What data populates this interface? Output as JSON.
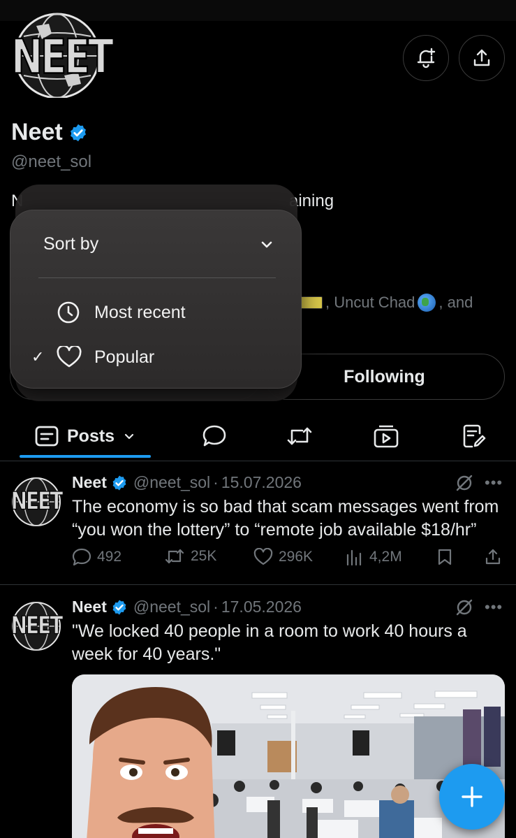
{
  "profile": {
    "name": "Neet",
    "handle": "@neet_sol",
    "logo_text": "NEET",
    "bio_fragment_left": "N",
    "bio_fragment_right": "aining",
    "followed_by": ", Uncut Chad",
    "followed_and": ", and",
    "following_label": "Following"
  },
  "header": {
    "notify_icon": "bell-plus-icon",
    "share_icon": "share-icon"
  },
  "sort_popover": {
    "title": "Sort by",
    "options": [
      {
        "label": "Most recent",
        "icon": "clock-icon",
        "selected": false
      },
      {
        "label": "Popular",
        "icon": "heart-icon",
        "selected": true
      }
    ]
  },
  "tabs": {
    "posts_label": "Posts",
    "items": [
      "posts",
      "replies",
      "reposts",
      "videos",
      "articles"
    ]
  },
  "posts": [
    {
      "name": "Neet",
      "handle": "@neet_sol",
      "date": "15.07.2026",
      "text": "The economy is so bad that scam messages went from “you won the lottery” to “remote job available $18/hr”",
      "replies": "492",
      "reposts": "25K",
      "likes": "296K",
      "views": "4,2M"
    },
    {
      "name": "Neet",
      "handle": "@neet_sol",
      "date": "17.05.2026",
      "text": "\"We locked 40 people in a room to work 40 hours a week for 40 years.\""
    }
  ],
  "colors": {
    "accent": "#1d9bf0",
    "verified": "#1d9bf0",
    "muted": "#71767b",
    "background": "#000000"
  }
}
